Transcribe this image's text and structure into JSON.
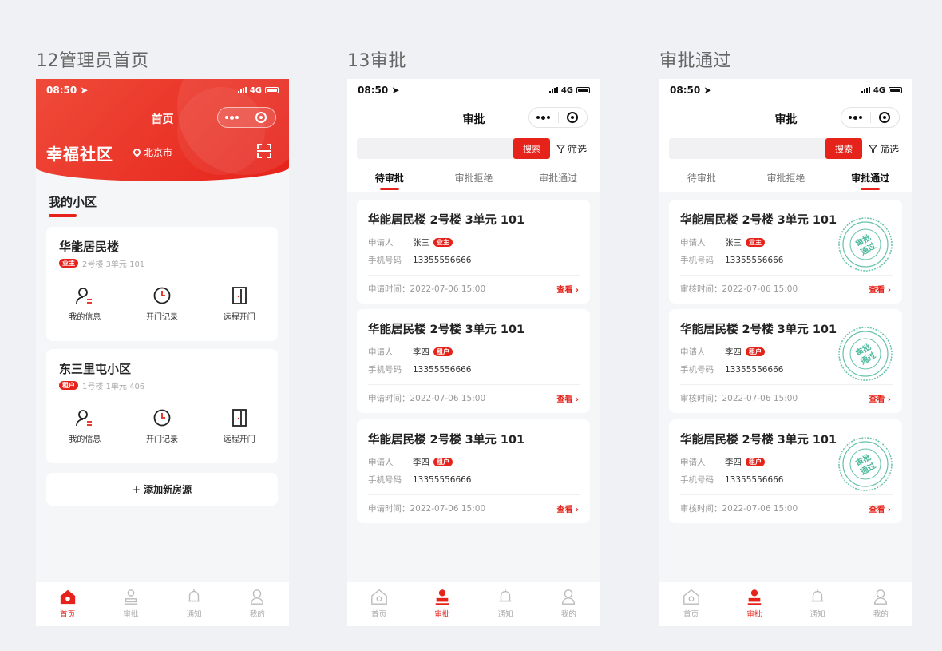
{
  "screen_titles": [
    "12管理员首页",
    "13审批",
    "审批通过"
  ],
  "status_bar": {
    "time": "08:50",
    "network": "4G"
  },
  "home": {
    "nav_title": "首页",
    "brand": "幸福社区",
    "city": "北京市",
    "section_title": "我的小区",
    "communities": [
      {
        "name": "华能居民楼",
        "tag": "业主",
        "address": "2号楼 3单元 101"
      },
      {
        "name": "东三里屯小区",
        "tag": "租户",
        "address": "1号楼 1单元 406"
      }
    ],
    "actions": [
      "我的信息",
      "开门记录",
      "远程开门"
    ],
    "add_house": "+ 添加新房源"
  },
  "approval": {
    "nav_title": "审批",
    "search_button": "搜索",
    "filter_label": "筛选",
    "tabs": [
      "待审批",
      "审批拒绝",
      "审批通过"
    ],
    "labels": {
      "applicant": "申请人",
      "phone": "手机号码",
      "apply_time": "申请时间：",
      "review_time": "审核时间：",
      "view": "查看 ›"
    },
    "pending_cards": [
      {
        "address": "华能居民楼 2号楼 3单元 101",
        "applicant": "张三",
        "tag": "业主",
        "phone": "13355556666",
        "time": "2022-07-06 15:00"
      },
      {
        "address": "华能居民楼 2号楼 3单元 101",
        "applicant": "李四",
        "tag": "租户",
        "phone": "13355556666",
        "time": "2022-07-06 15:00"
      },
      {
        "address": "华能居民楼 2号楼 3单元 101",
        "applicant": "李四",
        "tag": "租户",
        "phone": "13355556666",
        "time": "2022-07-06 15:00"
      }
    ],
    "approved_cards": [
      {
        "address": "华能居民楼 2号楼 3单元 101",
        "applicant": "张三",
        "tag": "业主",
        "phone": "13355556666",
        "time": "2022-07-06 15:00"
      },
      {
        "address": "华能居民楼 2号楼 3单元 101",
        "applicant": "李四",
        "tag": "租户",
        "phone": "13355556666",
        "time": "2022-07-06 15:00"
      },
      {
        "address": "华能居民楼 2号楼 3单元 101",
        "applicant": "李四",
        "tag": "租户",
        "phone": "13355556666",
        "time": "2022-07-06 15:00"
      }
    ],
    "stamp_text": [
      "审批",
      "通过"
    ]
  },
  "tabbar": [
    "首页",
    "审批",
    "通知",
    "我的"
  ],
  "colors": {
    "accent": "#e6231b",
    "stamp": "#3db394",
    "background": "#f5f6f8"
  }
}
